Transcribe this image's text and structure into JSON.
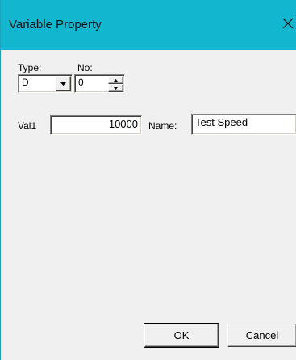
{
  "window": {
    "title": "Variable Property"
  },
  "type": {
    "label": "Type:",
    "selected": "D"
  },
  "no": {
    "label": "No:",
    "value": "0"
  },
  "val1": {
    "label": "Val1",
    "value": "10000"
  },
  "name": {
    "label": "Name:",
    "value": "Test Speed"
  },
  "buttons": {
    "ok_label": "OK",
    "cancel_label": "Cancel"
  },
  "icons": {
    "close": "close-icon",
    "dropdown": "chevron-down-icon",
    "spin_up": "arrow-up-icon",
    "spin_down": "arrow-down-icon"
  },
  "colors": {
    "titlebar": "#13b6cf",
    "dialog_bg": "#f0f0f0"
  }
}
